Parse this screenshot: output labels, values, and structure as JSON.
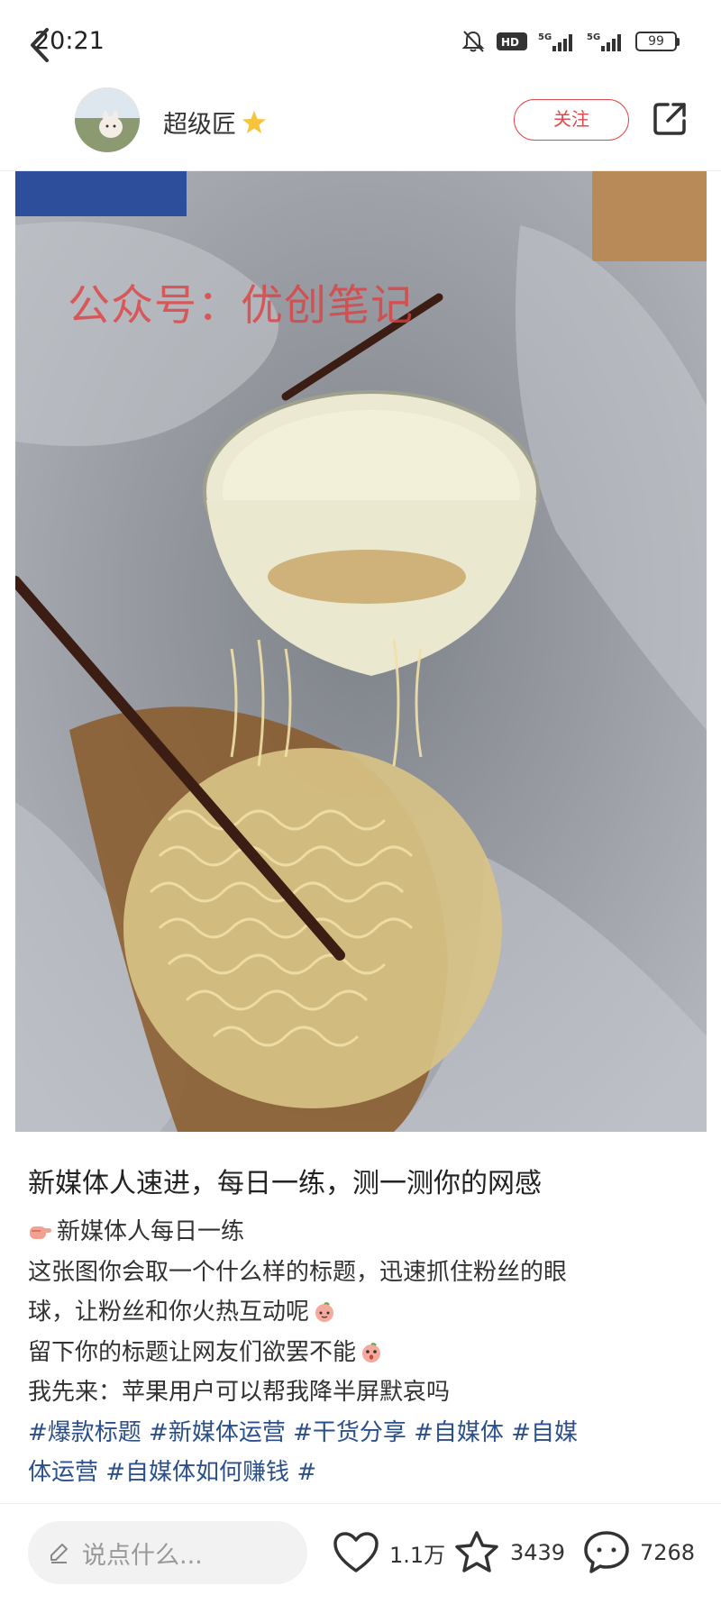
{
  "status_bar": {
    "time": "20:21",
    "battery": "99"
  },
  "header": {
    "author": "超级匠",
    "follow_label": "关注"
  },
  "photo": {
    "watermark": "公众号：优创笔记"
  },
  "post": {
    "title": "新媒体人速进，每日一练，测一测你的网感",
    "lines": [
      "新媒体人每日一练",
      "这张图你会取一个什么样的标题，迅速抓住粉丝的眼",
      "球，让粉丝和你火热互动呢",
      "留下你的标题让网友们欲罢不能",
      "我先来：苹果用户可以帮我降半屏默哀吗"
    ],
    "tags_line1": "#爆款标题 #新媒体运营 #干货分享 #自媒体 #自媒",
    "tags_line2": "体运营 #自媒体如何赚钱 #"
  },
  "bottom_bar": {
    "comment_placeholder": "说点什么...",
    "likes": "1.1万",
    "favorites": "3439",
    "comments": "7268"
  },
  "colors": {
    "accent": "#e0484a",
    "tag": "#2b4f8a"
  }
}
